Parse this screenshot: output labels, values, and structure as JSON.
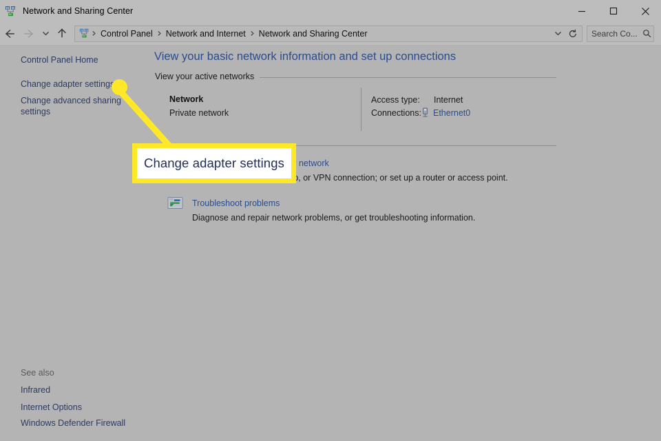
{
  "window": {
    "title": "Network and Sharing Center",
    "icon": "network-sharing-icon",
    "minimize_label": "—",
    "maximize_label": "□",
    "close_label": "✕"
  },
  "navbar": {
    "back_icon": "back-arrow-icon",
    "forward_icon": "forward-arrow-icon",
    "recent_icon": "chevron-down-icon",
    "up_icon": "up-arrow-icon",
    "refresh_icon": "refresh-icon",
    "address_dropdown_icon": "chevron-down-icon",
    "breadcrumbs": [
      "Control Panel",
      "Network and Internet",
      "Network and Sharing Center"
    ],
    "separator": "›"
  },
  "search": {
    "placeholder": "Search Co...",
    "value": "",
    "icon": "search-icon"
  },
  "sidebar": {
    "home_label": "Control Panel Home",
    "links": [
      "Change adapter settings",
      "Change advanced sharing settings"
    ],
    "see_also_label": "See also",
    "see_also": [
      "Infrared",
      "Internet Options",
      "Windows Defender Firewall"
    ]
  },
  "main": {
    "page_title": "View your basic network information and set up connections",
    "active_networks_heading": "View your active networks",
    "network": {
      "name": "Network",
      "type": "Private network",
      "access_type_label": "Access type:",
      "access_type_value": "Internet",
      "connections_label": "Connections:",
      "connection_name": "Ethernet0",
      "connection_icon": "ethernet-plug-icon"
    },
    "settings_items": [
      {
        "icon": "new-connection-icon",
        "link": "Set up a new connection or network",
        "description": "Set up a broadband, dial-up, or VPN connection; or set up a router or access point."
      },
      {
        "icon": "troubleshoot-icon",
        "link": "Troubleshoot problems",
        "description": "Diagnose and repair network problems, or get troubleshooting information."
      }
    ]
  },
  "annotation": {
    "callout_text": "Change adapter settings",
    "highlight_color": "#ffe827",
    "callout_background": "#ffffff",
    "callout_text_color": "#1f2d57"
  }
}
